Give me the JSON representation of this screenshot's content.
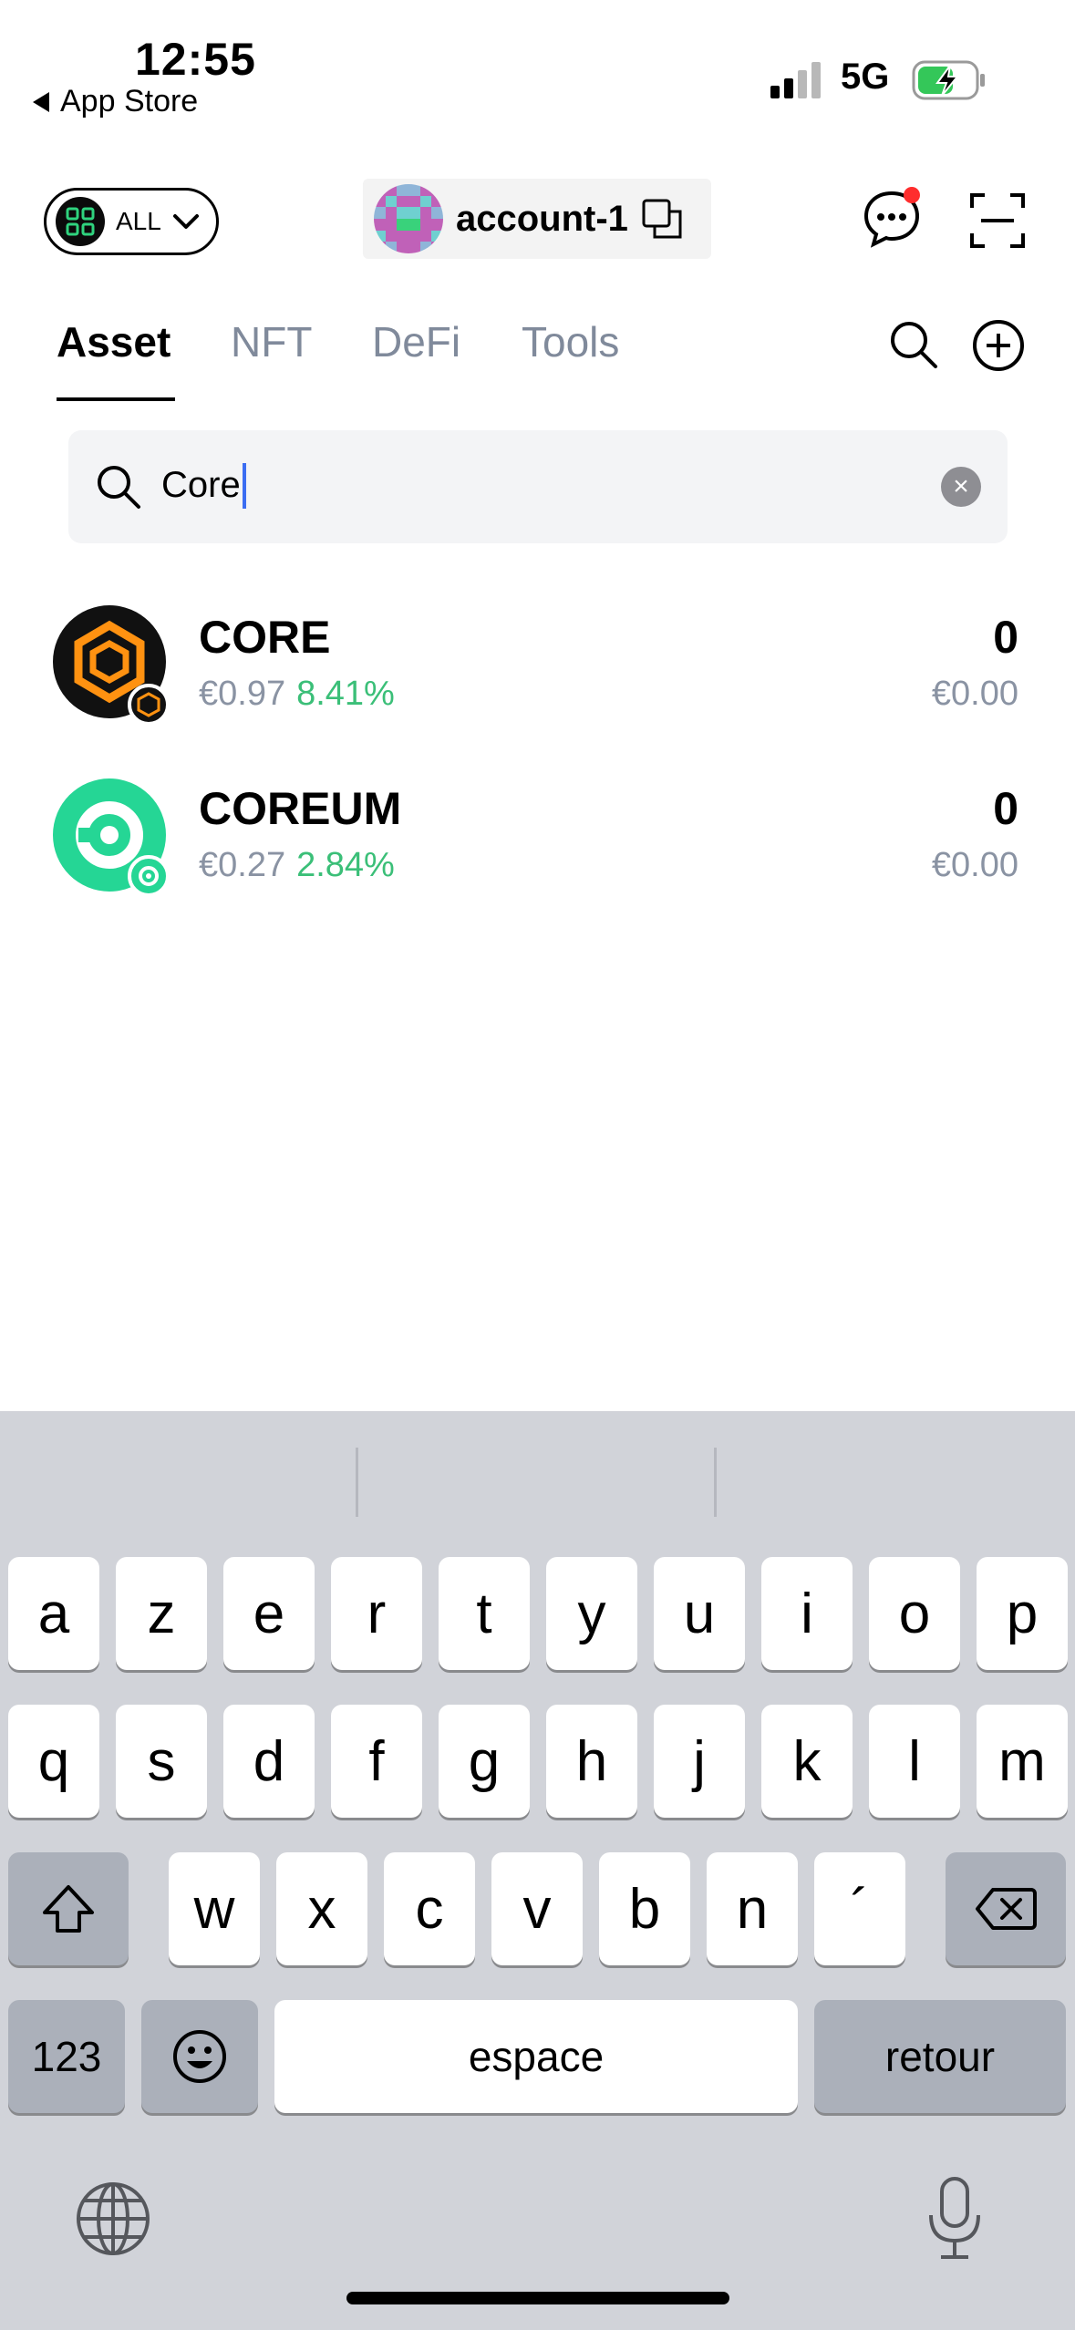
{
  "status_bar": {
    "time": "12:55",
    "back_label": "App Store",
    "network": "5G"
  },
  "header": {
    "filter_label": "ALL",
    "account_name": "account-1"
  },
  "tabs": [
    {
      "label": "Asset",
      "active": true
    },
    {
      "label": "NFT",
      "active": false
    },
    {
      "label": "DeFi",
      "active": false
    },
    {
      "label": "Tools",
      "active": false
    }
  ],
  "search": {
    "value": "Core"
  },
  "assets": [
    {
      "symbol": "CORE",
      "price": "€0.97",
      "change": "8.41%",
      "balance": "0",
      "value": "€0.00",
      "color": "#111111"
    },
    {
      "symbol": "COREUM",
      "price": "€0.27",
      "change": "2.84%",
      "balance": "0",
      "value": "€0.00",
      "color": "#25d695"
    }
  ],
  "keyboard": {
    "row1": [
      "a",
      "z",
      "e",
      "r",
      "t",
      "y",
      "u",
      "i",
      "o",
      "p"
    ],
    "row2": [
      "q",
      "s",
      "d",
      "f",
      "g",
      "h",
      "j",
      "k",
      "l",
      "m"
    ],
    "row3": [
      "w",
      "x",
      "c",
      "v",
      "b",
      "n",
      "´"
    ],
    "numbers_label": "123",
    "space_label": "espace",
    "return_label": "retour"
  },
  "colors": {
    "positive": "#3bbf78",
    "muted": "#8a93a3",
    "notification": "#ff2d2d",
    "battery": "#34c759"
  }
}
